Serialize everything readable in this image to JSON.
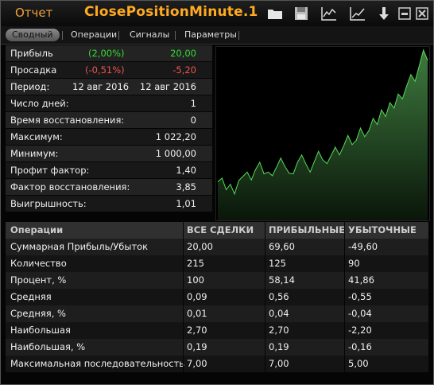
{
  "window": {
    "label": "Отчет",
    "title": "ClosePositionMinute.1"
  },
  "toolbar": [
    "folder-icon",
    "save-icon",
    "chart-settings-icon",
    "chart-icon",
    "download-icon",
    "minimize-icon",
    "close-icon"
  ],
  "tabs": [
    {
      "label": "Сводный",
      "active": true
    },
    {
      "label": "Операции",
      "active": false
    },
    {
      "label": "Сигналы",
      "active": false
    },
    {
      "label": "Параметры",
      "active": false
    }
  ],
  "summary": [
    {
      "label": "Прибыль",
      "pct": "(2,00%)",
      "value": "20,00",
      "color": "#33dd33"
    },
    {
      "label": "Просадка",
      "pct": "(-0,51%)",
      "value": "-5,20",
      "color": "#ee4444"
    },
    {
      "label": "Период:",
      "pct": "12 авг 2016",
      "value": "12 авг 2016"
    },
    {
      "label": "Число дней:",
      "value": "1"
    },
    {
      "label": "Время восстановления:",
      "value": "0"
    },
    {
      "label": "Максимум:",
      "value": "1 022,20"
    },
    {
      "label": "Минимум:",
      "value": "1 000,00"
    },
    {
      "label": "Профит фактор:",
      "value": "1,40"
    },
    {
      "label": "Фактор восстановления:",
      "value": "3,85"
    },
    {
      "label": "Выигрышность:",
      "value": "1,01"
    }
  ],
  "table": {
    "headers": [
      "Операции",
      "ВСЕ СДЕЛКИ",
      "ПРИБЫЛЬНЫЕ",
      "УБЫТОЧНЫЕ"
    ],
    "rows": [
      [
        "Суммарная Прибыль/Убыток",
        "20,00",
        "69,60",
        "-49,60"
      ],
      [
        "Количество",
        "215",
        "125",
        "90"
      ],
      [
        "Процент, %",
        "100",
        "58,14",
        "41,86"
      ],
      [
        "Средняя",
        "0,09",
        "0,56",
        "-0,55"
      ],
      [
        "Средняя, %",
        "0,01",
        "0,04",
        "-0,04"
      ],
      [
        "Наибольшая",
        "2,70",
        "2,70",
        "-2,20"
      ],
      [
        "Наибольшая, %",
        "0,19",
        "0,19",
        "-0,16"
      ],
      [
        "Максимальная последовательность",
        "7,00",
        "7,00",
        "5,00"
      ]
    ]
  },
  "equity": {
    "color": "#55dd55",
    "ylim": [
      994.8,
      1022.2
    ],
    "values": [
      1000.6,
      1001.2,
      999.3,
      1000.2,
      998.6,
      1000.8,
      1001.5,
      1002.2,
      1000.9,
      1002.6,
      1003.8,
      1001.9,
      1002.2,
      1001.6,
      1003.0,
      1004.5,
      1003.1,
      1002.0,
      1001.9,
      1003.8,
      1005.0,
      1003.5,
      1002.2,
      1003.9,
      1005.6,
      1004.2,
      1003.6,
      1004.9,
      1006.3,
      1005.0,
      1006.5,
      1008.2,
      1006.7,
      1007.4,
      1009.4,
      1008.0,
      1009.0,
      1011.0,
      1010.0,
      1012.4,
      1011.3,
      1013.6,
      1012.7,
      1015.0,
      1014.2,
      1016.3,
      1018.2,
      1017.1,
      1019.6,
      1022.2,
      1020.5
    ]
  }
}
